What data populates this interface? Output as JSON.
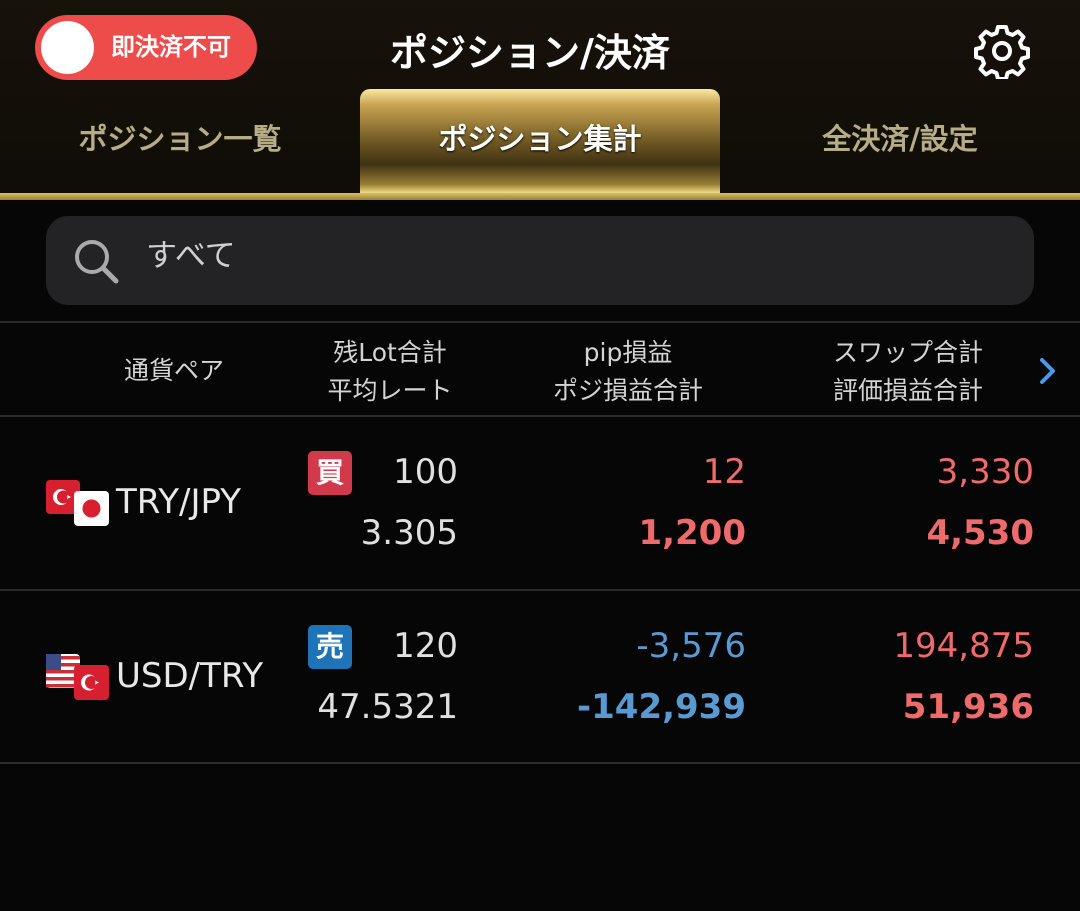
{
  "header": {
    "toggle_label": "即決済不可",
    "title": "ポジション/決済"
  },
  "tabs": [
    {
      "label": "ポジション一覧"
    },
    {
      "label": "ポジション集計",
      "active": true
    },
    {
      "label": "全決済/設定"
    }
  ],
  "search": {
    "value": "すべて"
  },
  "table": {
    "headers": {
      "pair": "通貨ペア",
      "lot_total": "残Lot合計",
      "avg_rate": "平均レート",
      "pip": "pip損益",
      "position_pl": "ポジ損益合計",
      "swap_total": "スワップ合計",
      "eval_pl": "評価損益合計"
    },
    "rows": [
      {
        "pair": "TRY/JPY",
        "side": "買",
        "lots": "100",
        "avg_rate": "3.305",
        "pip": "12",
        "position_pl": "1,200",
        "swap_total": "3,330",
        "eval_pl": "4,530"
      },
      {
        "pair": "USD/TRY",
        "side": "売",
        "lots": "120",
        "avg_rate": "47.5321",
        "pip": "-3,576",
        "position_pl": "-142,939",
        "swap_total": "194,875",
        "eval_pl": "51,936"
      }
    ]
  },
  "colors": {
    "positive": "#ef6a6a",
    "negative": "#5a9ad3",
    "buy_badge": "#d03a4b",
    "sell_badge": "#1f73b7",
    "toggle": "#ee4b4b"
  },
  "icons": [
    "gear-icon",
    "search-icon",
    "chevron-right-icon",
    "flag-tr-icon",
    "flag-jp-icon",
    "flag-us-icon"
  ]
}
